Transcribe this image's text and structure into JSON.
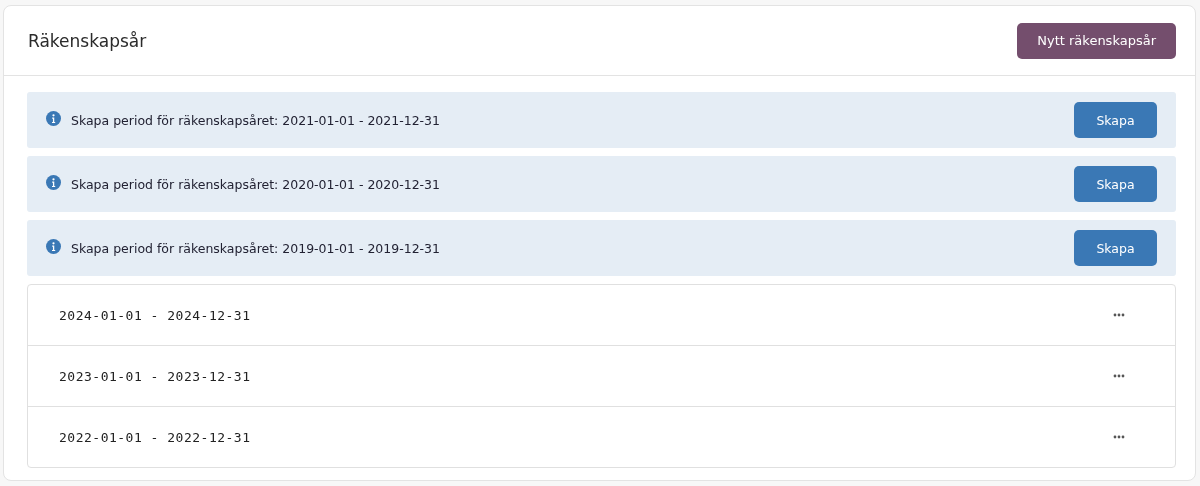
{
  "header": {
    "title": "Räkenskapsår",
    "new_button": "Nytt räkenskapsår"
  },
  "notices": [
    {
      "text": "Skapa period för räkenskapsåret: 2021-01-01 - 2021-12-31",
      "button": "Skapa"
    },
    {
      "text": "Skapa period för räkenskapsåret: 2020-01-01 - 2020-12-31",
      "button": "Skapa"
    },
    {
      "text": "Skapa period för räkenskapsåret: 2019-01-01 - 2019-12-31",
      "button": "Skapa"
    }
  ],
  "years": [
    {
      "period": "2024-01-01 - 2024-12-31"
    },
    {
      "period": "2023-01-01 - 2023-12-31"
    },
    {
      "period": "2022-01-01 - 2022-12-31"
    }
  ]
}
